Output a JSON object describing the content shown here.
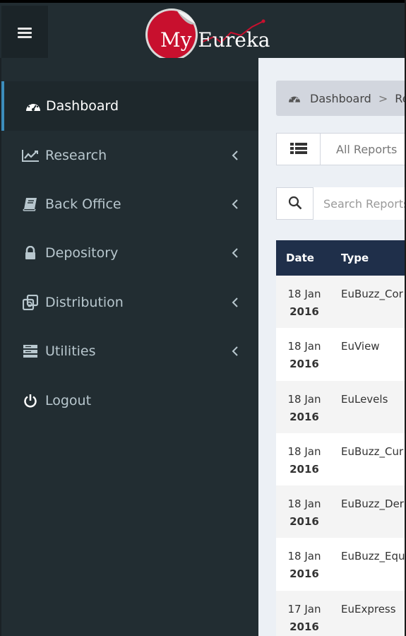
{
  "header": {
    "menu_icon": "hamburger-icon",
    "logo_text": "My Eureka",
    "logo_badge_color": "#c8102e"
  },
  "sidebar": {
    "items": [
      {
        "label": "Dashboard",
        "icon": "dashboard-icon",
        "active": true,
        "has_submenu": false
      },
      {
        "label": "Research",
        "icon": "line-chart-icon",
        "active": false,
        "has_submenu": true
      },
      {
        "label": "Back Office",
        "icon": "book-icon",
        "active": false,
        "has_submenu": true
      },
      {
        "label": "Depository",
        "icon": "lock-icon",
        "active": false,
        "has_submenu": true
      },
      {
        "label": "Distribution",
        "icon": "clone-icon",
        "active": false,
        "has_submenu": true
      },
      {
        "label": "Utilities",
        "icon": "server-icon",
        "active": false,
        "has_submenu": true
      },
      {
        "label": "Logout",
        "icon": "power-icon",
        "active": false,
        "has_submenu": false
      }
    ],
    "active_accent": "#3c8dbc"
  },
  "breadcrumb": {
    "home": "Dashboard",
    "separator": ">",
    "next": "Re"
  },
  "filter": {
    "icon": "list-icon",
    "label": "All Reports"
  },
  "search": {
    "icon": "search-icon",
    "placeholder": "Search Reports"
  },
  "table": {
    "header_color": "#1f2f4a",
    "columns": [
      "Date",
      "Type"
    ],
    "rows": [
      {
        "day": "18 Jan",
        "year": "2016",
        "type": "EuBuzz_Cor"
      },
      {
        "day": "18 Jan",
        "year": "2016",
        "type": "EuView"
      },
      {
        "day": "18 Jan",
        "year": "2016",
        "type": "EuLevels"
      },
      {
        "day": "18 Jan",
        "year": "2016",
        "type": "EuBuzz_Cur"
      },
      {
        "day": "18 Jan",
        "year": "2016",
        "type": "EuBuzz_Der"
      },
      {
        "day": "18 Jan",
        "year": "2016",
        "type": "EuBuzz_Equ"
      },
      {
        "day": "17 Jan",
        "year": "2016",
        "type": "EuExpress"
      }
    ]
  }
}
